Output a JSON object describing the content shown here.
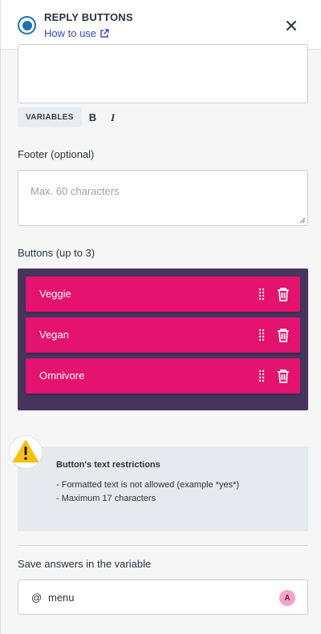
{
  "header": {
    "title": "REPLY BUTTONS",
    "help_link": "How to use",
    "icon": "circle-dot-icon",
    "close_icon": "close-icon"
  },
  "editor": {
    "variables_label": "VARIABLES",
    "bold_label": "B",
    "italic_label": "I"
  },
  "footer": {
    "label": "Footer (optional)",
    "placeholder": "Max. 60 characters",
    "value": ""
  },
  "buttons": {
    "label": "Buttons (up to 3)",
    "items": [
      {
        "label": "Veggie"
      },
      {
        "label": "Vegan"
      },
      {
        "label": "Omnivore"
      }
    ]
  },
  "warning": {
    "icon": "warning-icon",
    "title": "Button's text restrictions",
    "lines": [
      "- Formatted text is not allowed (example *yes*)",
      "- Maximum 17 characters"
    ]
  },
  "save_variable": {
    "label": "Save answers in the variable",
    "prefix": "@",
    "value": "menu",
    "avatar_letter": "A"
  },
  "colors": {
    "accent": "#3d43c4",
    "button_bg": "#e3136f",
    "buttons_block_bg": "#46365f",
    "warning_bg": "#e6e9ed",
    "brand_blue": "#1c70ad"
  }
}
